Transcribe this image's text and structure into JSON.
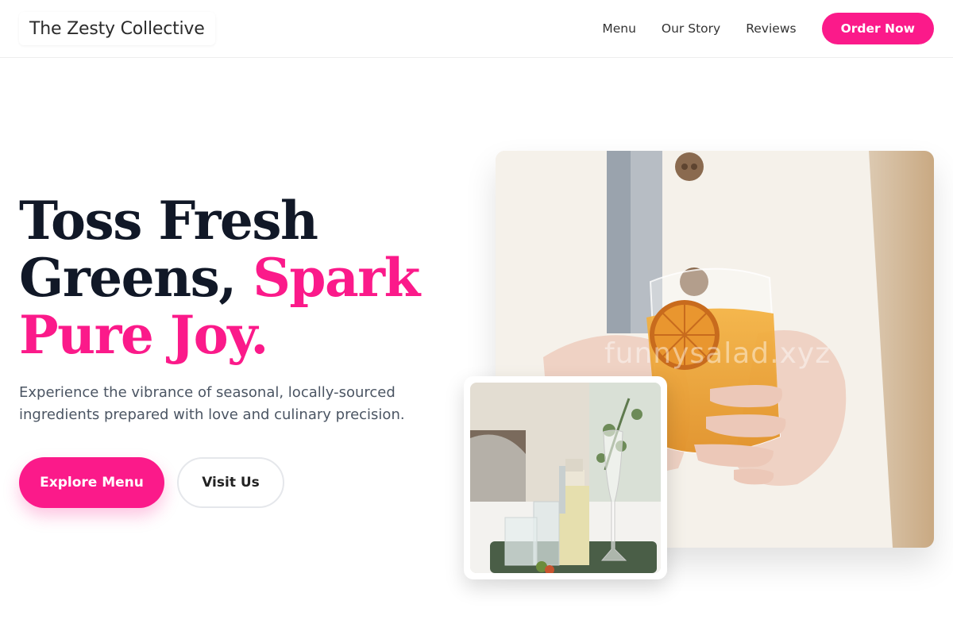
{
  "header": {
    "logo": "The Zesty Collective",
    "nav": [
      "Menu",
      "Our Story",
      "Reviews"
    ],
    "cta": "Order Now"
  },
  "hero": {
    "title_line1": "Toss Fresh",
    "title_line2": "Greens,",
    "title_accent1": "Spark",
    "title_accent2": "Pure Joy.",
    "subtitle": "Experience the vibrance of seasonal, locally-sourced ingredients prepared with love and culinary precision.",
    "primary_button": "Explore Menu",
    "secondary_button": "Visit Us"
  },
  "images": {
    "main_watermark": "funnysalad.xyz"
  },
  "colors": {
    "accent": "#fb1a8a",
    "heading": "#111827",
    "body_text": "#4b5563"
  }
}
